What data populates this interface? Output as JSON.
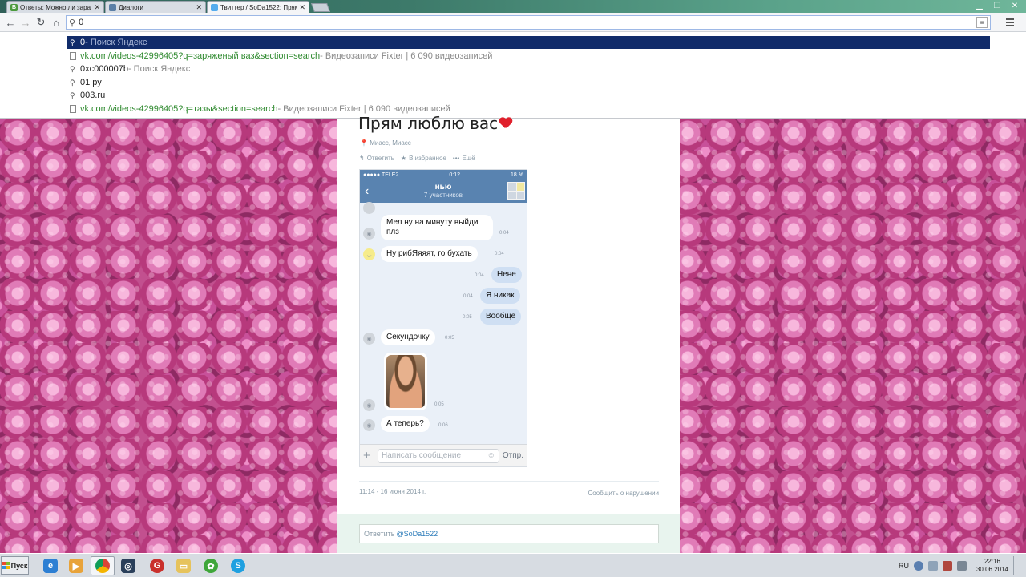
{
  "browser": {
    "tabs": [
      {
        "title": "Ответы: Можно ли зарабо",
        "favicon": "vk-icon",
        "color": "#4c9a3c"
      },
      {
        "title": "Диалоги",
        "favicon": "vk-icon",
        "color": "#5b7fa6"
      },
      {
        "title": "Твиттер / SoDa1522: Прям",
        "favicon": "twitter-bird-icon",
        "color": "#55acee"
      }
    ],
    "omnibox_value": "0",
    "suggestions": [
      {
        "main": "0",
        "desc": " - Поиск Яндекс",
        "kind": "search"
      },
      {
        "main": "vk.com/videos-42996405?q=заряженый ваз&section=search",
        "desc": " - Видеозаписи Fixter | 6 090 видеозаписей",
        "kind": "url"
      },
      {
        "main": "0xc000007b",
        "desc": " - Поиск Яндекс",
        "kind": "search"
      },
      {
        "main": "01 ру",
        "desc": "",
        "kind": "search"
      },
      {
        "main": "003.ru",
        "desc": "",
        "kind": "search"
      },
      {
        "main": "vk.com/videos-42996405?q=тазы&section=search",
        "desc": " - Видеозаписи Fixter | 6 090 видеозаписей",
        "kind": "url"
      }
    ]
  },
  "tweet": {
    "title": "Прям люблю вас",
    "location": "Миасс, Миасс",
    "actions": {
      "reply": "Ответить",
      "favorite": "В избранное",
      "more": "Ещё"
    },
    "timestamp": "11:14 - 16 июня 2014 г.",
    "report": "Сообщить о нарушении",
    "reply_prefix": "Ответить",
    "reply_handle": "@SoDa1522"
  },
  "phone": {
    "carrier": "●●●●● TELE2",
    "time": "0:12",
    "battery": "18 %",
    "chat_title": "нью",
    "chat_subtitle": "7 участников",
    "messages": [
      {
        "text": "Мел ну на минуту выйди плз",
        "time": "0:04",
        "dir": "in"
      },
      {
        "text": "Ну рибЯяяят, го бухать",
        "time": "0:04",
        "dir": "in"
      },
      {
        "text": "Нене",
        "time": "0:04",
        "dir": "out"
      },
      {
        "text": "Я никак",
        "time": "0:04",
        "dir": "out"
      },
      {
        "text": "Вообще",
        "time": "0:05",
        "dir": "out"
      },
      {
        "text": "Секундочку",
        "time": "0:05",
        "dir": "in"
      },
      {
        "text": "",
        "time": "0:05",
        "dir": "in"
      },
      {
        "text": "А теперь?",
        "time": "0:06",
        "dir": "in"
      }
    ],
    "input_placeholder": "Написать сообщение",
    "send_label": "Отпр."
  },
  "taskbar": {
    "start_label": "Пуск",
    "lang": "RU",
    "time": "22:16",
    "date": "30.06.2014"
  }
}
